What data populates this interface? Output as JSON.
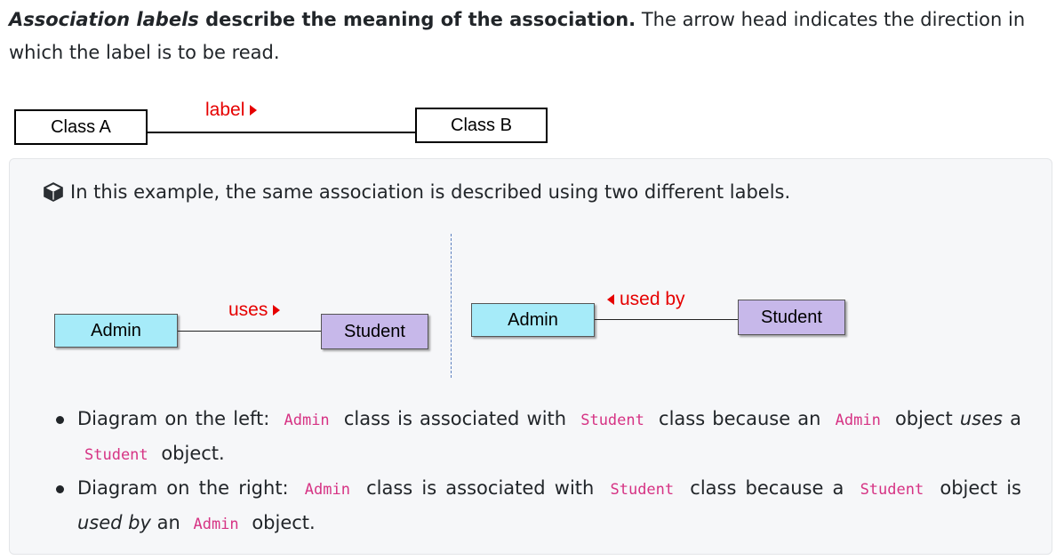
{
  "intro": {
    "term": "Association labels",
    "bold_rest": " describe the meaning of the association.",
    "rest": " The arrow head indicates the direction in which the label is to be read."
  },
  "top_diagram": {
    "class_a": "Class A",
    "class_b": "Class B",
    "label": "label"
  },
  "example": {
    "heading": "In this example, the same association is described using two different labels.",
    "left": {
      "from": "Admin",
      "to": "Student",
      "label": "uses"
    },
    "right": {
      "from": "Admin",
      "to": "Student",
      "label": "used by"
    }
  },
  "bullets": {
    "b1": {
      "lead": "Diagram on the left: ",
      "c1": "Admin",
      "t1": " class is associated with ",
      "c2": "Student",
      "t2": " class because an ",
      "c3": "Admin",
      "t3": " object ",
      "em": "uses",
      "t4": " a ",
      "c4": "Student",
      "t5": " object."
    },
    "b2": {
      "lead": "Diagram on the right: ",
      "c1": "Admin",
      "t1": " class is associated with ",
      "c2": "Student",
      "t2": " class because a ",
      "c3": "Student",
      "t3": " object is ",
      "em": "used by",
      "t4": " an ",
      "c4": "Admin",
      "t5": " object."
    }
  },
  "colors": {
    "label_red": "#e60000",
    "code_pink": "#d63384",
    "admin_fill": "#a6ebf9",
    "student_fill": "#c7b8ea"
  }
}
